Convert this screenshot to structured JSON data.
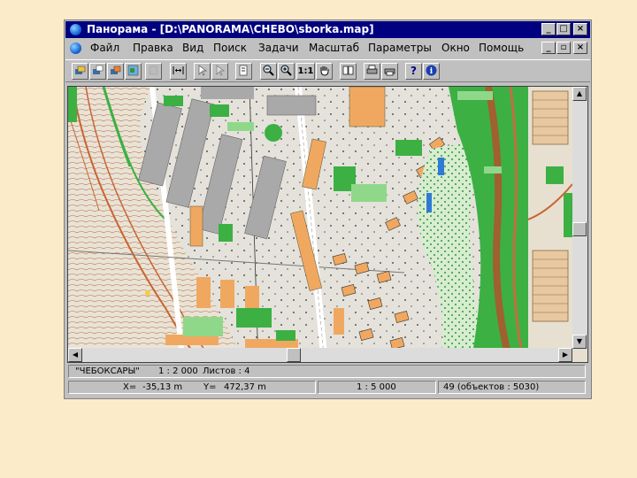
{
  "window": {
    "title": "Панорама - [D:\\PANORAMA\\CHEBO\\sborka.map]",
    "controls": {
      "minimize": "_",
      "maximize": "□",
      "close": "×"
    },
    "child_controls": {
      "minimize": "_",
      "restore": "▫",
      "close": "×"
    }
  },
  "menu": {
    "items": [
      "Файл",
      "Правка",
      "Вид",
      "Поиск",
      "Задачи",
      "Масштаб",
      "Параметры",
      "Окно",
      "Помощь"
    ]
  },
  "toolbar": {
    "buttons": [
      {
        "icon": "layers-icon"
      },
      {
        "icon": "layers-add-icon"
      },
      {
        "icon": "layers-edit-icon"
      },
      {
        "icon": "map-icon"
      },
      {
        "icon": "blank-icon"
      },
      {
        "icon": "fit-width-icon"
      },
      {
        "icon": "arrow-select-icon"
      },
      {
        "icon": "arrow-select2-icon"
      },
      {
        "icon": "document-icon"
      },
      {
        "icon": "zoom-out-icon"
      },
      {
        "icon": "zoom-in-icon"
      },
      {
        "icon": "zoom-1-1-icon"
      },
      {
        "icon": "hand-icon"
      },
      {
        "icon": "book-icon"
      },
      {
        "icon": "printer-icon"
      },
      {
        "icon": "printer2-icon"
      },
      {
        "icon": "help-icon"
      },
      {
        "icon": "info-icon"
      }
    ],
    "zoom_label": "1:1",
    "help_label": "?",
    "info_label": "i"
  },
  "status": {
    "map_name": "\"ЧЕБОКСАРЫ\"",
    "scale": "1 : 2 000",
    "sheets": "Листов : 4",
    "x_label": "X=",
    "x_value": "-35,13 m",
    "y_label": "Y=",
    "y_value": "472,37 m",
    "view_scale": "1 : 5 000",
    "objects": "49  (объектов : 5030)"
  },
  "colors": {
    "title_bg": "#000080",
    "window_bg": "#c0c0c0",
    "page_bg": "#fbebc8",
    "building_orange": "#f0a860",
    "building_gray": "#a9a9a9",
    "vegetation": "#3cb043",
    "vegetation_light": "#8fd88a",
    "contour": "#c86432"
  }
}
